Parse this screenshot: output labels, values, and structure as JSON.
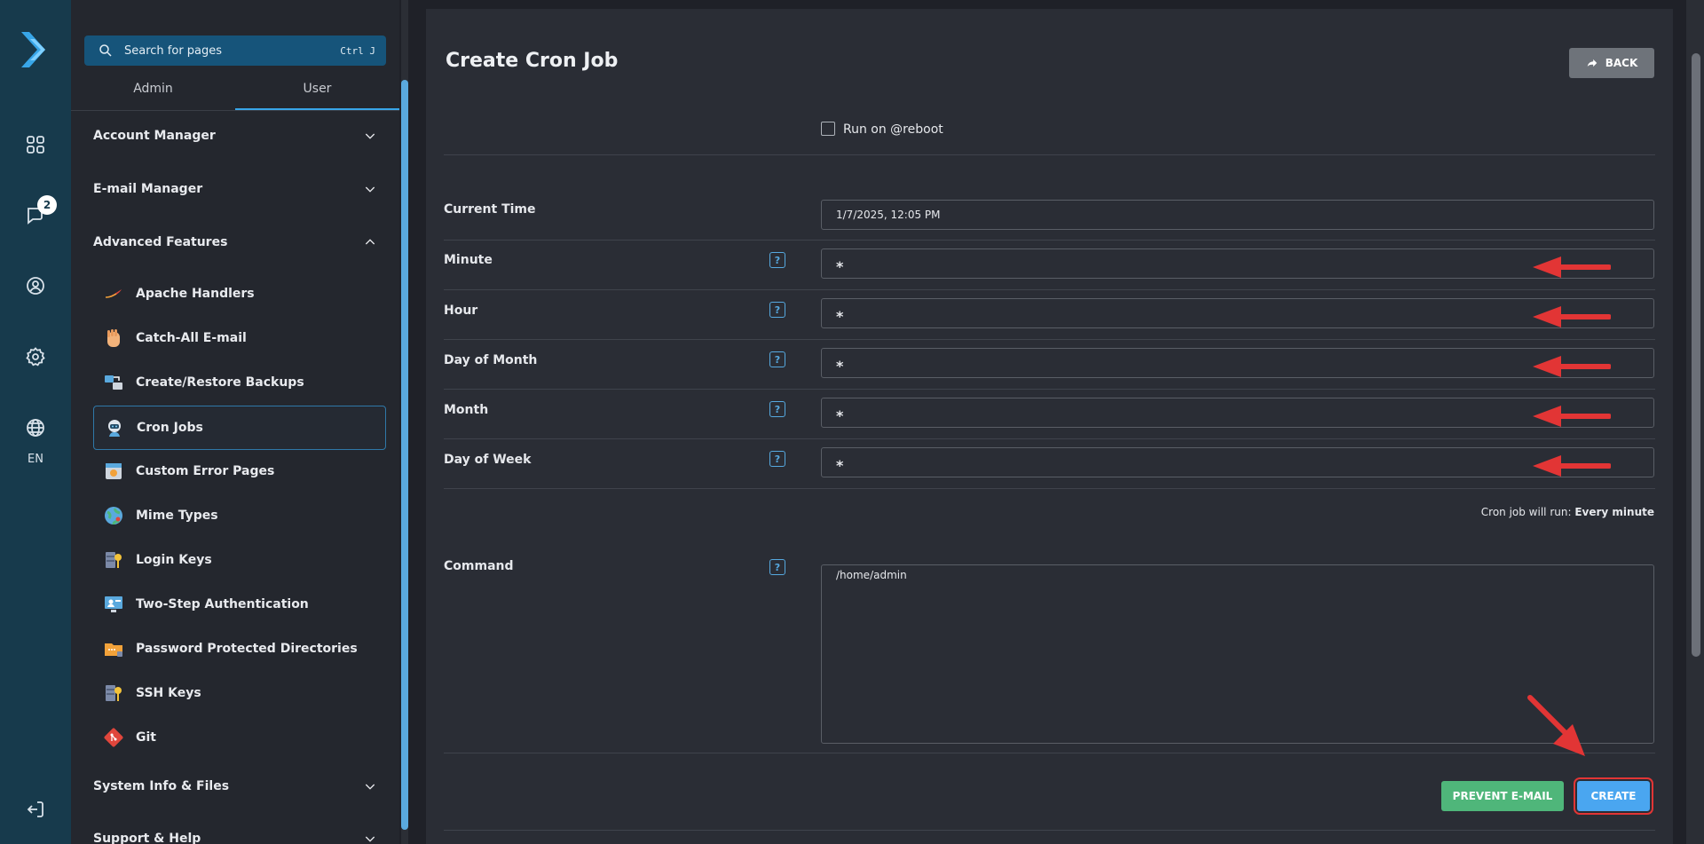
{
  "rail": {
    "notification_count": "2",
    "language": "EN"
  },
  "sidebar": {
    "search": {
      "placeholder": "Search for pages",
      "shortcut": "Ctrl J"
    },
    "tabs": [
      {
        "label": "Admin"
      },
      {
        "label": "User"
      }
    ],
    "sections": [
      {
        "label": "Account Manager"
      },
      {
        "label": "E-mail Manager"
      },
      {
        "label": "Advanced Features"
      },
      {
        "label": "System Info & Files"
      },
      {
        "label": "Support & Help"
      }
    ],
    "items": [
      {
        "label": "Apache Handlers"
      },
      {
        "label": "Catch-All E-mail"
      },
      {
        "label": "Create/Restore Backups"
      },
      {
        "label": "Cron Jobs"
      },
      {
        "label": "Custom Error Pages"
      },
      {
        "label": "Mime Types"
      },
      {
        "label": "Login Keys"
      },
      {
        "label": "Two-Step Authentication"
      },
      {
        "label": "Password Protected Directories"
      },
      {
        "label": "SSH Keys"
      },
      {
        "label": "Git"
      }
    ]
  },
  "main": {
    "title": "Create Cron Job",
    "back_label": "BACK",
    "reboot_label": "Run on @reboot",
    "current_time": {
      "label": "Current Time",
      "value": "1/7/2025, 12:05 PM"
    },
    "fields": [
      {
        "label": "Minute",
        "value": "*"
      },
      {
        "label": "Hour",
        "value": "*"
      },
      {
        "label": "Day of Month",
        "value": "*"
      },
      {
        "label": "Month",
        "value": "*"
      },
      {
        "label": "Day of Week",
        "value": "*"
      }
    ],
    "summary": {
      "prefix": "Cron job will run:",
      "value": "Every minute"
    },
    "command": {
      "label": "Command",
      "value": "/home/admin"
    },
    "help_glyph": "?",
    "prevent_label": "PREVENT E-MAIL",
    "create_label": "CREATE"
  },
  "colors": {
    "rail_bg": "#173a4c",
    "accent_blue": "#4aa6f0",
    "prevent_green": "#4fb67a",
    "annotation_red": "#e23535"
  }
}
